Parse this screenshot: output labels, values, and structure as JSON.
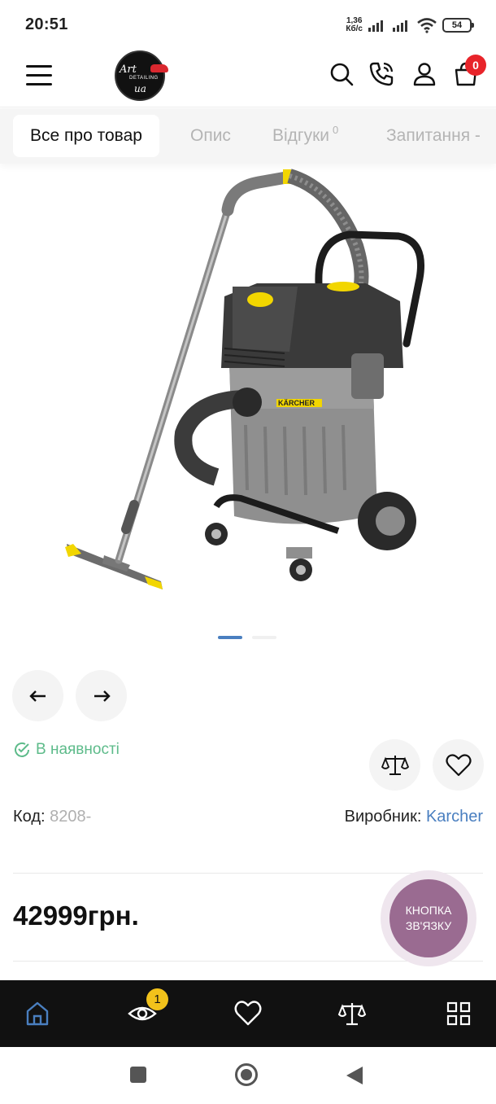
{
  "status_bar": {
    "time": "20:51",
    "net_speed_value": "1,36",
    "net_speed_unit": "Кб/с",
    "battery": "54",
    "icons": [
      "signal-icon",
      "signal-icon",
      "wifi-icon",
      "battery-icon"
    ]
  },
  "header": {
    "logo_text_top": "Art",
    "logo_text_middle": "DETAILING",
    "logo_text_bottom": "ua",
    "cart_count": "0",
    "icons": [
      "menu-icon",
      "search-icon",
      "phone-icon",
      "user-icon",
      "cart-icon"
    ]
  },
  "tabs": [
    {
      "label": "Все про товар",
      "active": true
    },
    {
      "label": "Опис"
    },
    {
      "label": "Відгуки",
      "count": "0"
    },
    {
      "label": "Запитання -"
    }
  ],
  "gallery": {
    "slides": 2,
    "active_slide": 1
  },
  "product": {
    "availability": "В наявності",
    "code_label": "Код:",
    "code_value": "8208-",
    "brand_label": "Виробник:",
    "brand_value": "Karcher",
    "brand_mark": "KÄRCHER",
    "price": "42999грн."
  },
  "contact_button": {
    "line1": "КНОПКА",
    "line2": "ЗВ'ЯЗКУ"
  },
  "bottom_nav": {
    "viewed_count": "1",
    "items": [
      "home-icon",
      "eye-icon",
      "heart-icon",
      "scales-icon",
      "grid-icon"
    ],
    "active_color": "#4a7fc0"
  },
  "colors": {
    "accent_blue": "#4a7fc0",
    "stock_green": "#5dbb8a",
    "badge_red": "#e8242a",
    "badge_yellow": "#f2c21b",
    "contact_purple": "#9a6b91"
  }
}
